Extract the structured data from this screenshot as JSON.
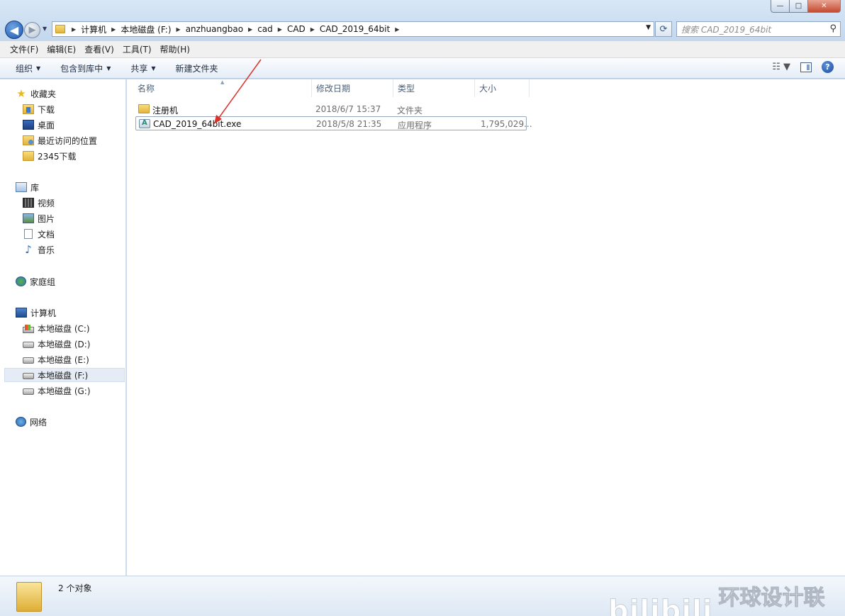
{
  "window": {
    "minimize_label": "—",
    "maximize_label": "□",
    "close_label": "✕"
  },
  "address": {
    "crumbs": [
      "计算机",
      "本地磁盘 (F:)",
      "anzhuangbao",
      "cad",
      "CAD",
      "CAD_2019_64bit"
    ]
  },
  "search": {
    "placeholder": "搜索 CAD_2019_64bit"
  },
  "menu": {
    "items": [
      "文件(F)",
      "编辑(E)",
      "查看(V)",
      "工具(T)",
      "帮助(H)"
    ]
  },
  "toolbar": {
    "organize": "组织",
    "include_library": "包含到库中",
    "share": "共享",
    "new_folder": "新建文件夹"
  },
  "nav": {
    "favorites": {
      "label": "收藏夹",
      "items": [
        "下载",
        "桌面",
        "最近访问的位置",
        "2345下载"
      ]
    },
    "libraries": {
      "label": "库",
      "items": [
        "视频",
        "图片",
        "文档",
        "音乐"
      ]
    },
    "homegroup": {
      "label": "家庭组"
    },
    "computer": {
      "label": "计算机",
      "drives": [
        "本地磁盘 (C:)",
        "本地磁盘 (D:)",
        "本地磁盘 (E:)",
        "本地磁盘 (F:)",
        "本地磁盘 (G:)"
      ],
      "selected": "本地磁盘 (F:)"
    },
    "network": {
      "label": "网络"
    }
  },
  "columns": {
    "name": "名称",
    "date": "修改日期",
    "type": "类型",
    "size": "大小"
  },
  "files": [
    {
      "name": "注册机",
      "date": "2018/6/7 15:37",
      "type": "文件夹",
      "size": "",
      "icon": "folder-icon"
    },
    {
      "name": "CAD_2019_64bit.exe",
      "date": "2018/5/8 21:35",
      "type": "应用程序",
      "size": "1,795,029...",
      "icon": "exe-icon"
    }
  ],
  "details": {
    "count": "2 个对象"
  },
  "watermark": {
    "logo": "bilibili",
    "text": "环球设计联盟"
  },
  "colors": {
    "annotation_arrow": "#d9342b",
    "window_frame": "#c9dcef"
  }
}
